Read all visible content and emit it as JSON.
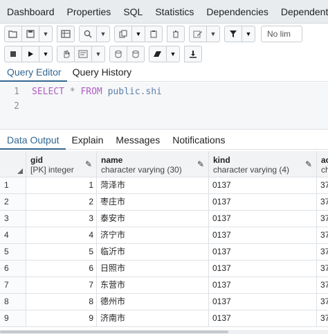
{
  "top_tabs": [
    "Dashboard",
    "Properties",
    "SQL",
    "Statistics",
    "Dependencies",
    "Dependents"
  ],
  "toolbar": {
    "row1": [
      "open-file-icon",
      "save-icon",
      "save-dropdown-icon",
      "table-icon",
      "search-icon",
      "search-dropdown-icon",
      "copy-icon",
      "copy-dropdown-icon",
      "paste-icon",
      "delete-icon",
      "edit-icon",
      "edit-dropdown-icon",
      "filter-icon",
      "filter-dropdown-icon"
    ],
    "limit_text": "No lim",
    "row2": [
      "stop-icon",
      "execute-icon",
      "execute-dropdown-icon",
      "hand-icon",
      "explain-icon",
      "explain-dropdown-icon",
      "commit-icon",
      "rollback-icon",
      "clear-icon",
      "clear-dropdown-icon",
      "download-icon"
    ]
  },
  "editor_tabs": [
    "Query Editor",
    "Query History"
  ],
  "editor": {
    "line_numbers": [
      "1",
      "2"
    ],
    "keyword_select": "SELECT",
    "star": "*",
    "keyword_from": "FROM",
    "schema": "public",
    "dot": ".",
    "table": "shi"
  },
  "output_tabs": [
    "Data Output",
    "Explain",
    "Messages",
    "Notifications"
  ],
  "columns": [
    {
      "name": "gid",
      "type": "[PK] integer"
    },
    {
      "name": "name",
      "type": "character varying (30)"
    },
    {
      "name": "kind",
      "type": "character varying (4)"
    },
    {
      "name": "ac",
      "type": "ch"
    }
  ],
  "rows": [
    {
      "n": "1",
      "gid": "1",
      "name": "菏泽市",
      "kind": "0137",
      "ac": "37"
    },
    {
      "n": "2",
      "gid": "2",
      "name": "枣庄市",
      "kind": "0137",
      "ac": "37"
    },
    {
      "n": "3",
      "gid": "3",
      "name": "泰安市",
      "kind": "0137",
      "ac": "37"
    },
    {
      "n": "4",
      "gid": "4",
      "name": "济宁市",
      "kind": "0137",
      "ac": "37"
    },
    {
      "n": "5",
      "gid": "5",
      "name": "临沂市",
      "kind": "0137",
      "ac": "37"
    },
    {
      "n": "6",
      "gid": "6",
      "name": "日照市",
      "kind": "0137",
      "ac": "37"
    },
    {
      "n": "7",
      "gid": "7",
      "name": "东营市",
      "kind": "0137",
      "ac": "37"
    },
    {
      "n": "8",
      "gid": "8",
      "name": "德州市",
      "kind": "0137",
      "ac": "37"
    },
    {
      "n": "9",
      "gid": "9",
      "name": "济南市",
      "kind": "0137",
      "ac": "37"
    }
  ],
  "accent_color": "#326690"
}
